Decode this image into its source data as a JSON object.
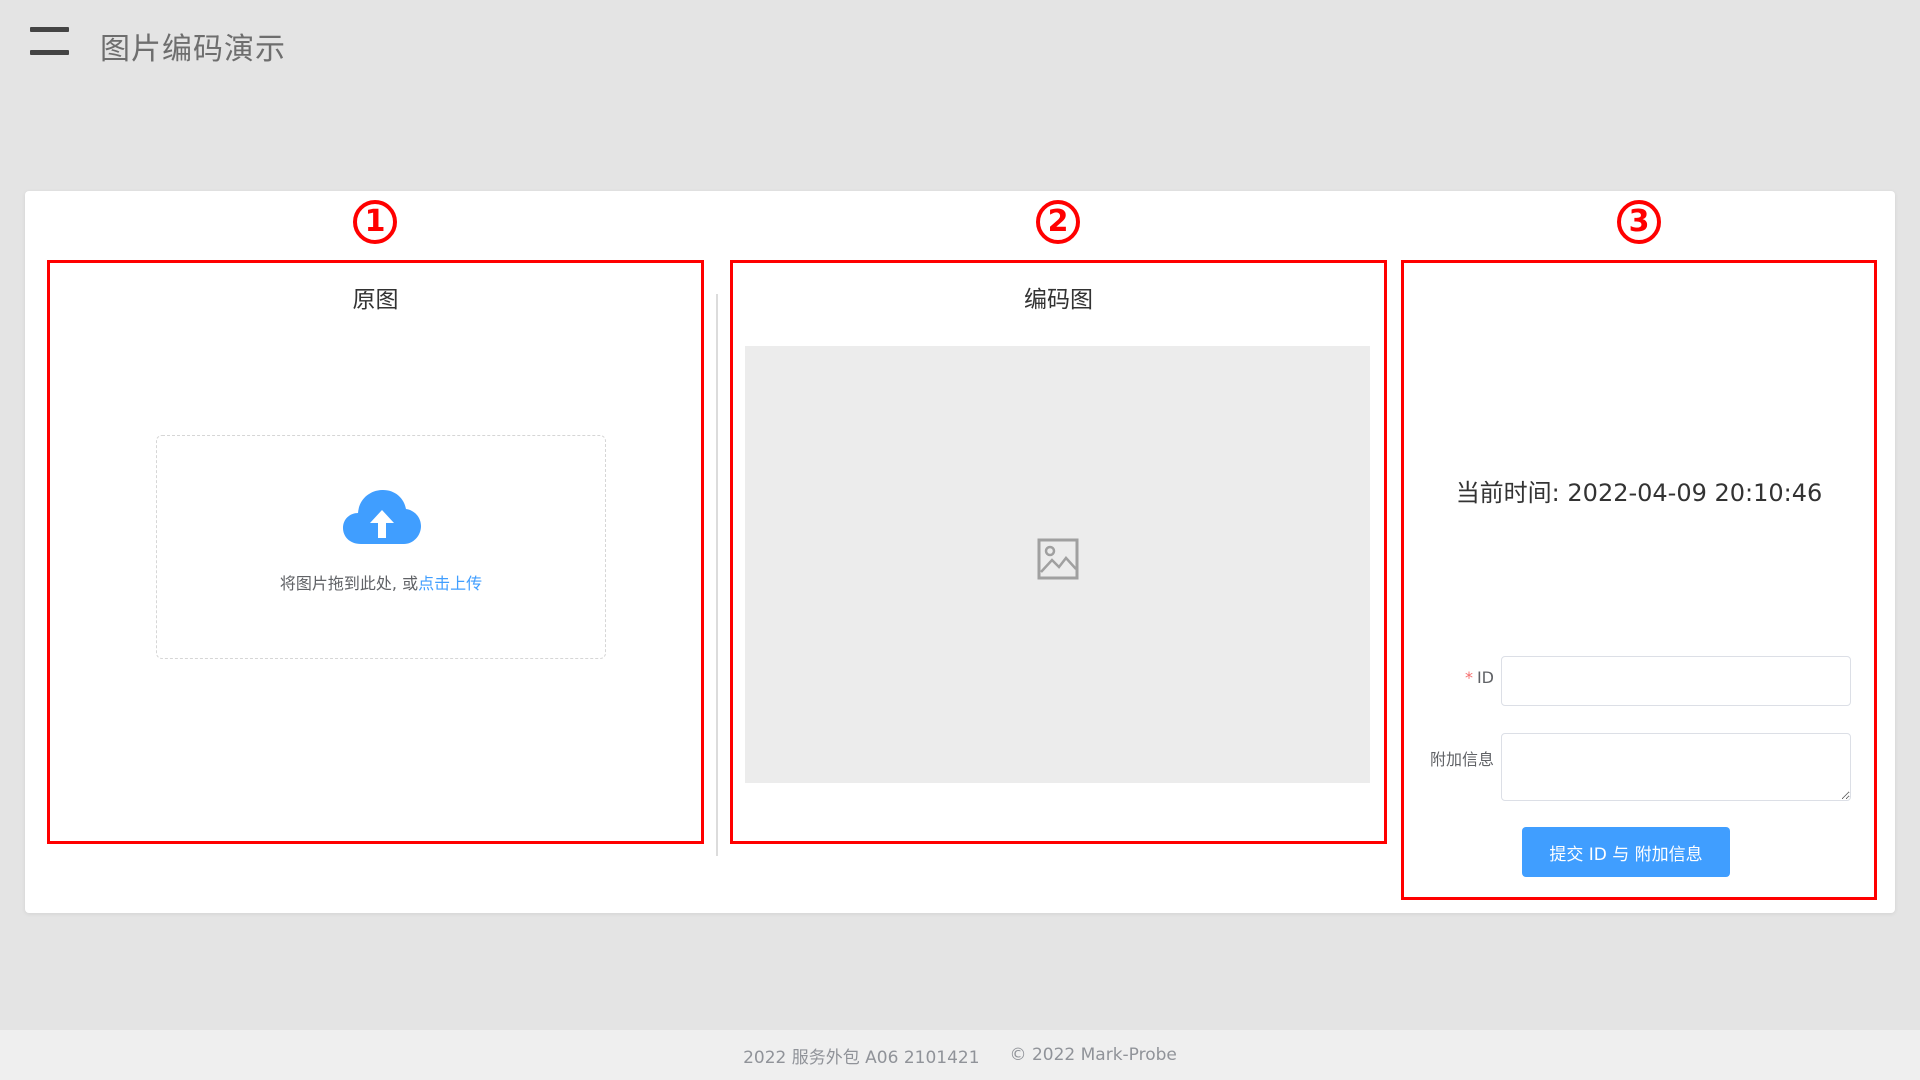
{
  "header": {
    "title": "图片编码演示",
    "menu_icon": "hamburger-menu-icon"
  },
  "markers": [
    "1",
    "2",
    "3"
  ],
  "original_panel": {
    "title": "原图",
    "upload_icon": "cloud-upload-icon",
    "upload_text": "将图片拖到此处, 或",
    "upload_link": "点击上传"
  },
  "encoded_panel": {
    "title": "编码图",
    "placeholder_icon": "image-placeholder-icon"
  },
  "form_panel": {
    "time_label": "当前时间: 2022-04-09 20:10:46",
    "id_label": "ID",
    "id_required_mark": "*",
    "id_value": "",
    "extra_label": "附加信息",
    "extra_value": "",
    "submit_label": "提交 ID 与 附加信息"
  },
  "colors": {
    "accent": "#409eff",
    "marker": "#ff0000",
    "background": "#e4e4e4"
  },
  "footer": {
    "left": "2022 服务外包 A06 2101421",
    "right": "© 2022 Mark-Probe"
  }
}
